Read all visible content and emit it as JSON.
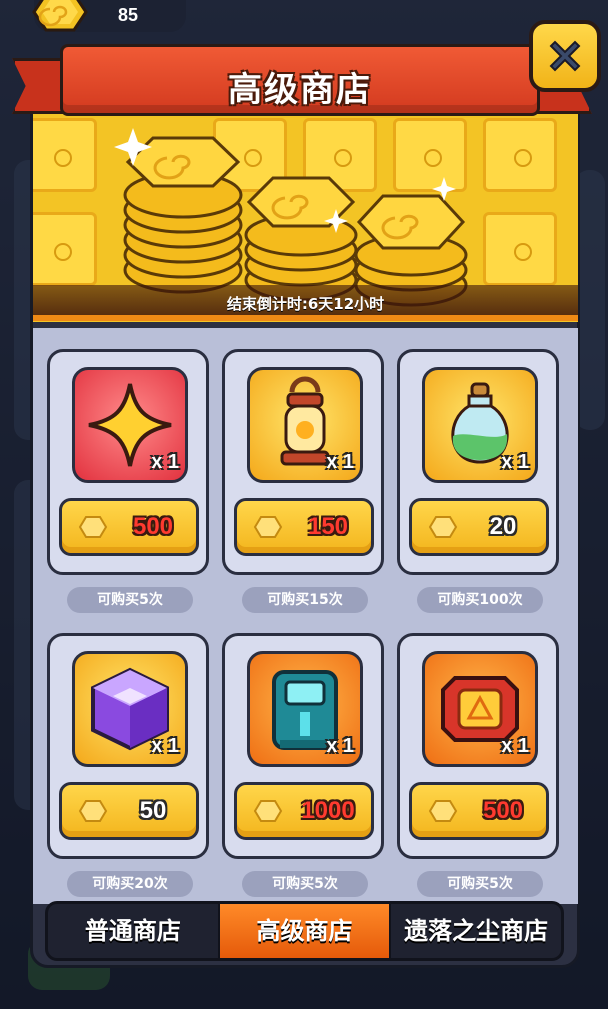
{
  "currency": {
    "icon": "coin-icon",
    "amount": "85"
  },
  "header": {
    "title": "高级商店",
    "close_icon": "close-icon"
  },
  "banner": {
    "countdown": "结束倒计时:6天12小时"
  },
  "items": [
    {
      "name": "star",
      "icon": "star-icon",
      "qty": "x 1",
      "price": "500",
      "price_color": "red",
      "limit": "可购买5次"
    },
    {
      "name": "lantern",
      "icon": "lantern-icon",
      "qty": "x 1",
      "price": "150",
      "price_color": "red",
      "limit": "可购买15次"
    },
    {
      "name": "potion",
      "icon": "potion-icon",
      "qty": "x 1",
      "price": "20",
      "price_color": "white",
      "limit": "可购买100次"
    },
    {
      "name": "cube",
      "icon": "purple-cube-icon",
      "qty": "x 1",
      "price": "50",
      "price_color": "white",
      "limit": "可购买20次"
    },
    {
      "name": "chip",
      "icon": "chip-icon",
      "qty": "x 1",
      "price": "1000",
      "price_color": "red",
      "limit": "可购买5次"
    },
    {
      "name": "core",
      "icon": "core-icon",
      "qty": "x 1",
      "price": "500",
      "price_color": "red",
      "limit": "可购买5次"
    }
  ],
  "tabs": [
    {
      "label": "普通商店",
      "active": false
    },
    {
      "label": "高级商店",
      "active": true
    },
    {
      "label": "遗落之尘商店",
      "active": false
    }
  ],
  "colors": {
    "price_red": "#ff3a2f",
    "tab_active": "#f0700f",
    "banner_gold": "#f3c425"
  }
}
